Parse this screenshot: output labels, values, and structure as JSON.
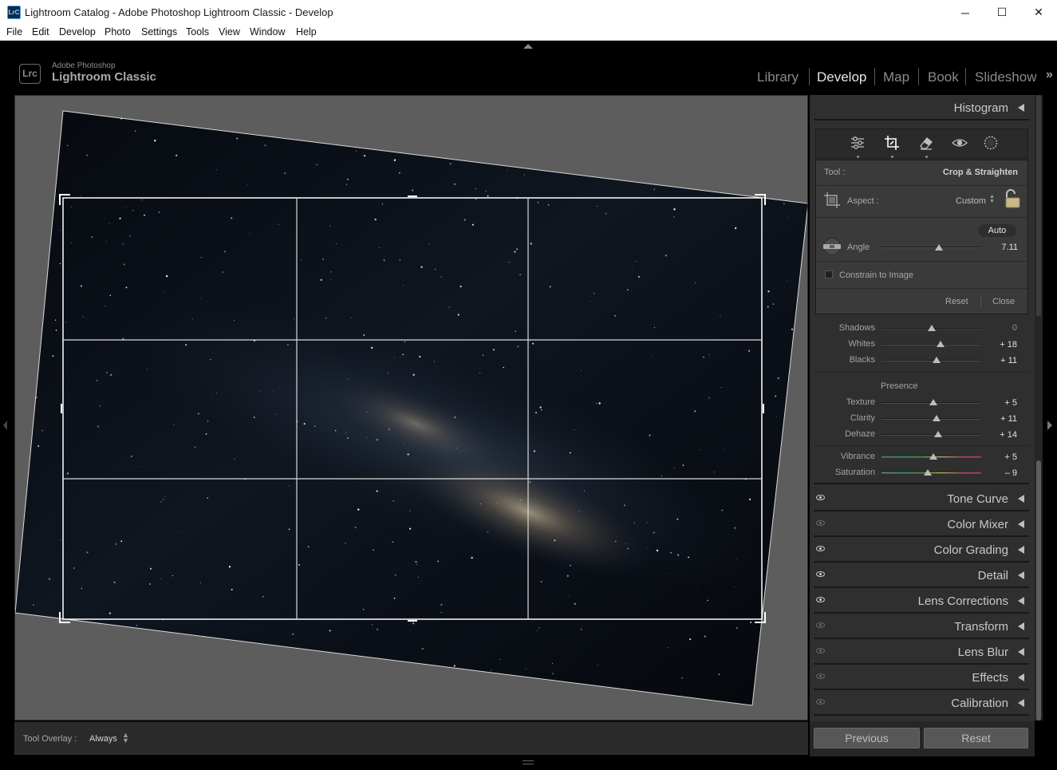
{
  "window": {
    "title": "Lightroom Catalog - Adobe Photoshop Lightroom Classic - Develop",
    "icon_text": "LrC",
    "controls": {
      "minimize": "─",
      "maximize": "☐",
      "close": "✕"
    }
  },
  "menu": [
    "File",
    "Edit",
    "Develop",
    "Photo",
    "Settings",
    "Tools",
    "View",
    "Window",
    "Help"
  ],
  "identity": {
    "logo": "Lrc",
    "brand_sub": "Adobe Photoshop",
    "brand_main": "Lightroom Classic",
    "modules": [
      "Library",
      "Develop",
      "Map",
      "Book",
      "Slideshow"
    ],
    "active_module": "Develop",
    "more": "»"
  },
  "toolbar": {
    "tool_overlay_label": "Tool Overlay :",
    "tool_overlay_value": "Always"
  },
  "right_panel": {
    "histogram": "Histogram",
    "tools": [
      "edit-sliders-icon",
      "crop-icon",
      "healing-eraser-icon",
      "red-eye-icon",
      "masking-icon"
    ],
    "active_tool": "crop-icon",
    "crop": {
      "tool_label": "Tool :",
      "tool_name": "Crop & Straighten",
      "aspect_label": "Aspect :",
      "aspect_value": "Custom",
      "auto_button": "Auto",
      "angle_label": "Angle",
      "angle_value": "7.11",
      "angle_position": 0.58,
      "constrain_label": "Constrain to Image",
      "constrain_checked": false,
      "reset": "Reset",
      "close": "Close"
    },
    "basic": {
      "tone_sliders": [
        {
          "label": "Shadows",
          "value": "0",
          "position": 0.5
        },
        {
          "label": "Whites",
          "value": "+ 18",
          "position": 0.59
        },
        {
          "label": "Blacks",
          "value": "+ 11",
          "position": 0.55
        }
      ],
      "presence_title": "Presence",
      "presence_sliders": [
        {
          "label": "Texture",
          "value": "+ 5",
          "position": 0.52
        },
        {
          "label": "Clarity",
          "value": "+ 11",
          "position": 0.55
        },
        {
          "label": "Dehaze",
          "value": "+ 14",
          "position": 0.57
        }
      ],
      "color_sliders": [
        {
          "label": "Vibrance",
          "value": "+ 5",
          "position": 0.52
        },
        {
          "label": "Saturation",
          "value": "– 9",
          "position": 0.46
        }
      ]
    },
    "panels": [
      {
        "label": "Tone Curve",
        "eye": "on"
      },
      {
        "label": "Color Mixer",
        "eye": "dim"
      },
      {
        "label": "Color Grading",
        "eye": "on"
      },
      {
        "label": "Detail",
        "eye": "on"
      },
      {
        "label": "Lens Corrections",
        "eye": "on"
      },
      {
        "label": "Transform",
        "eye": "dim"
      },
      {
        "label": "Lens Blur",
        "eye": "dim"
      },
      {
        "label": "Effects",
        "eye": "dim"
      },
      {
        "label": "Calibration",
        "eye": "dim"
      }
    ],
    "previous": "Previous",
    "reset": "Reset"
  }
}
